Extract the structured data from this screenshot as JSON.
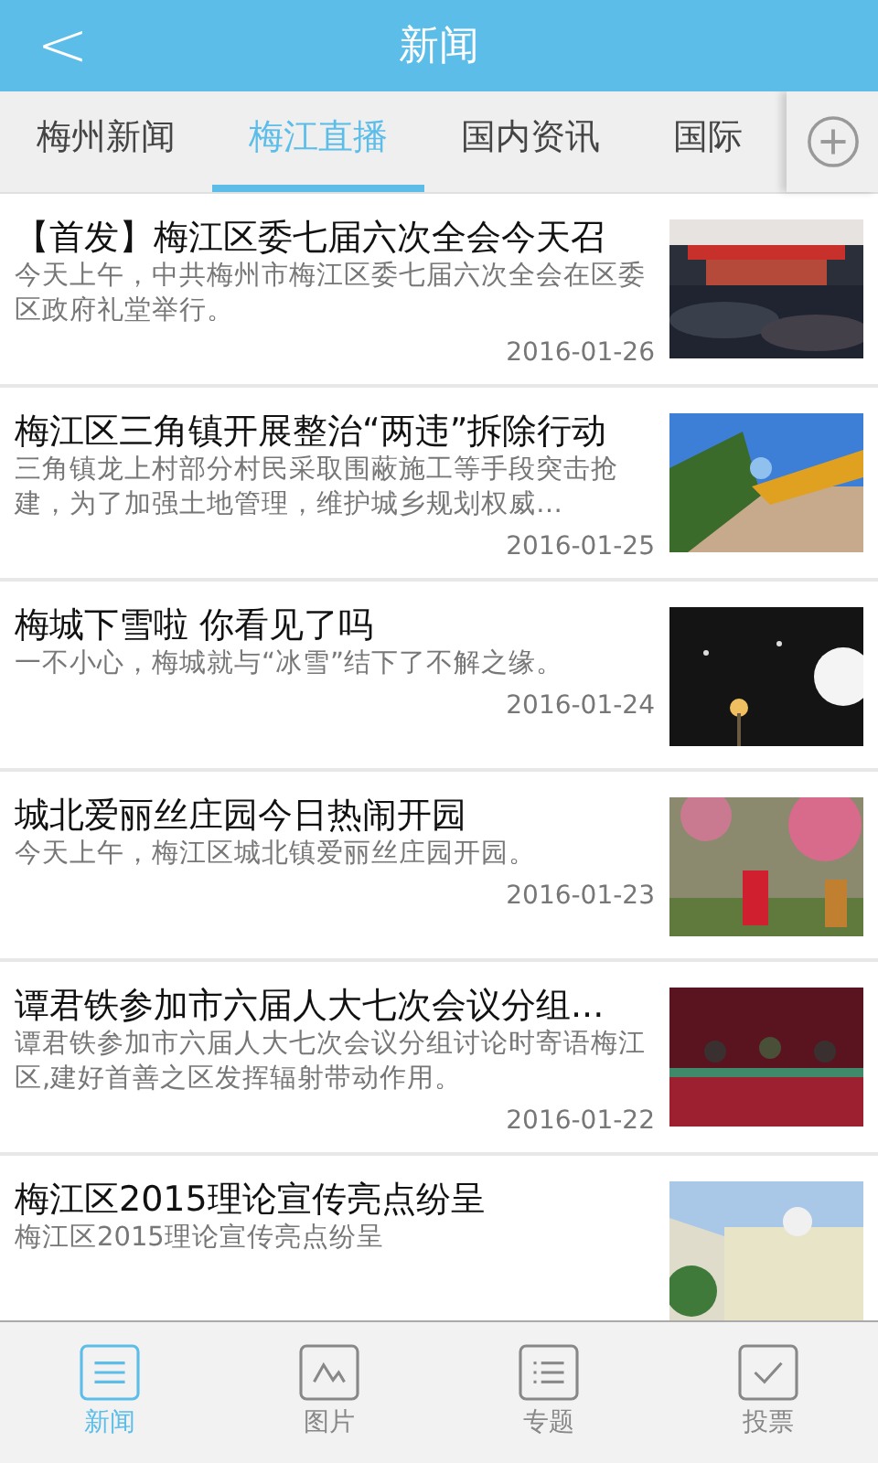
{
  "header": {
    "back": "<",
    "title": "新闻"
  },
  "tabs": [
    {
      "label": "梅州新闻",
      "selected": false
    },
    {
      "label": "梅江直播",
      "selected": true
    },
    {
      "label": "国内资讯",
      "selected": false
    },
    {
      "label": "国际",
      "selected": false
    }
  ],
  "articles": [
    {
      "title": "【首发】梅江区委七届六次全会今天召",
      "summary": "今天上午，中共梅州市梅江区委七届六次全会在区委区政府礼堂举行。",
      "date": "2016-01-26"
    },
    {
      "title": "梅江区三角镇开展整治“两违”拆除行动",
      "summary": "三角镇龙上村部分村民采取围蔽施工等手段突击抢建，为了加强土地管理，维护城乡规划权威…",
      "date": "2016-01-25"
    },
    {
      "title": "梅城下雪啦 你看见了吗",
      "summary": "一不小心，梅城就与“冰雪”结下了不解之缘。",
      "date": "2016-01-24"
    },
    {
      "title": "城北爱丽丝庄园今日热闹开园",
      "summary": "今天上午，梅江区城北镇爱丽丝庄园开园。",
      "date": "2016-01-23"
    },
    {
      "title": "谭君铁参加市六届人大七次会议分组...",
      "summary": "谭君铁参加市六届人大七次会议分组讨论时寄语梅江区,建好首善之区发挥辐射带动作用。",
      "date": "2016-01-22"
    },
    {
      "title": "梅江区2015理论宣传亮点纷呈",
      "summary": "梅江区2015理论宣传亮点纷呈"
    }
  ],
  "bottom_nav": [
    {
      "label": "新闻",
      "kind": "news",
      "selected": true
    },
    {
      "label": "图片",
      "kind": "photos",
      "selected": false
    },
    {
      "label": "专题",
      "kind": "topics",
      "selected": false
    },
    {
      "label": "投票",
      "kind": "vote",
      "selected": false
    }
  ]
}
